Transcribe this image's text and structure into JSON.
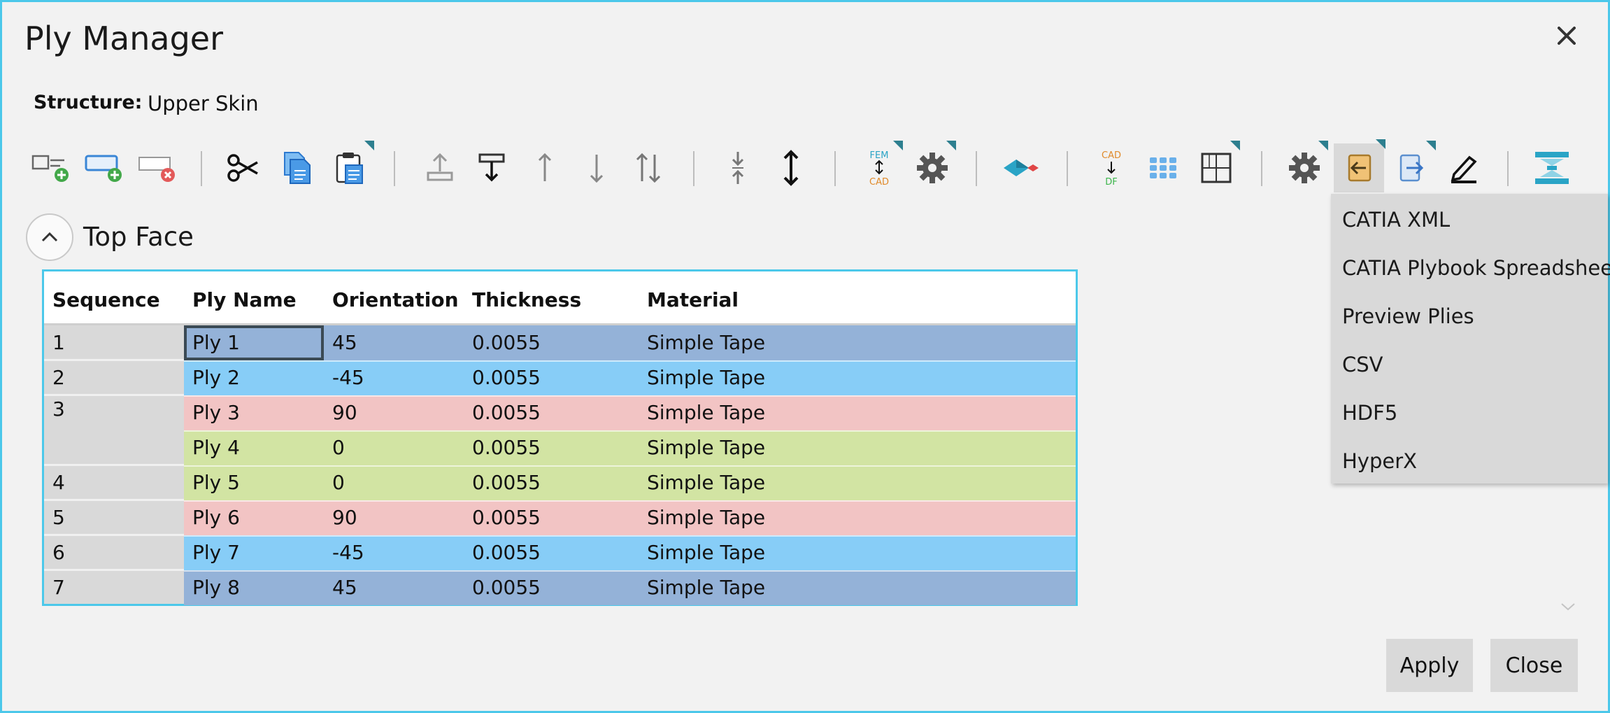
{
  "window": {
    "title": "Ply Manager",
    "close_icon": "close-icon"
  },
  "structure": {
    "label": "Structure:",
    "value": "Upper Skin"
  },
  "toolbar": {
    "icons": [
      "add-ply-icon",
      "add-sequence-icon",
      "remove-icon",
      "cut-icon",
      "copy-icon",
      "paste-icon",
      "move-to-top-icon",
      "move-to-bottom-icon",
      "move-up-icon",
      "move-down-icon",
      "swap-icon",
      "compress-icon",
      "expand-icon",
      "fem-cad-icon",
      "settings-icon",
      "projection-icon",
      "cad-df-icon",
      "grid-icon",
      "layout-icon",
      "settings-icon",
      "import-icon",
      "export-icon",
      "edit-icon",
      "stack-icon"
    ],
    "labels": {
      "fem": "FEM",
      "cad": "CAD",
      "df": "DF"
    }
  },
  "section": {
    "title": "Top Face"
  },
  "table": {
    "columns": [
      "Sequence",
      "Ply Name",
      "Orientation",
      "Thickness",
      "Material"
    ],
    "sequences": [
      "1",
      "2",
      "3",
      "4",
      "5",
      "6",
      "7"
    ],
    "rows": [
      {
        "ply": "Ply 1",
        "orientation": "45",
        "thickness": "0.0055",
        "material": "Simple Tape",
        "color": "#94b2d8"
      },
      {
        "ply": "Ply 2",
        "orientation": "-45",
        "thickness": "0.0055",
        "material": "Simple Tape",
        "color": "#87cdf7"
      },
      {
        "ply": "Ply 3",
        "orientation": "90",
        "thickness": "0.0055",
        "material": "Simple Tape",
        "color": "#f2c4c4"
      },
      {
        "ply": "Ply 4",
        "orientation": "0",
        "thickness": "0.0055",
        "material": "Simple Tape",
        "color": "#d2e4a3"
      },
      {
        "ply": "Ply 5",
        "orientation": "0",
        "thickness": "0.0055",
        "material": "Simple Tape",
        "color": "#d2e4a3"
      },
      {
        "ply": "Ply 6",
        "orientation": "90",
        "thickness": "0.0055",
        "material": "Simple Tape",
        "color": "#f2c4c4"
      },
      {
        "ply": "Ply 7",
        "orientation": "-45",
        "thickness": "0.0055",
        "material": "Simple Tape",
        "color": "#87cdf7"
      },
      {
        "ply": "Ply 8",
        "orientation": "45",
        "thickness": "0.0055",
        "material": "Simple Tape",
        "color": "#94b2d8"
      }
    ]
  },
  "dropdown": {
    "items": [
      "CATIA XML",
      "CATIA Plybook Spreadsheet",
      "Preview Plies",
      "CSV",
      "HDF5",
      "HyperX"
    ]
  },
  "buttons": {
    "apply": "Apply",
    "close": "Close"
  },
  "colors": {
    "accent_border": "#4cc8ea",
    "sequence_column": "#d9d9d9",
    "selected_outline": "#3b4a55"
  }
}
